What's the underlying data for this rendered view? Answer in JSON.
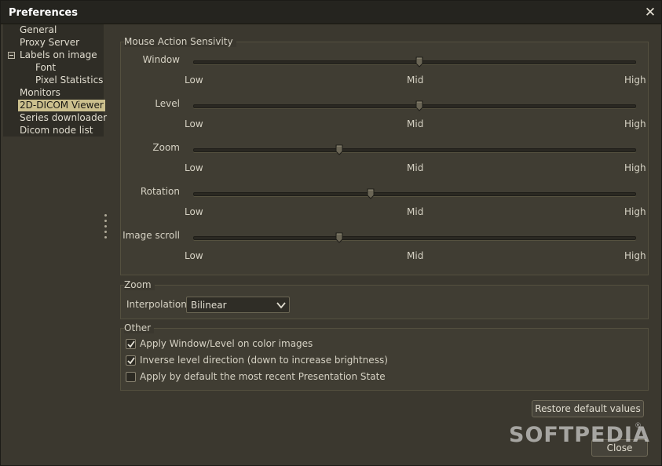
{
  "window": {
    "title": "Preferences"
  },
  "tree": [
    {
      "label": "General",
      "level": 1,
      "selected": false
    },
    {
      "label": "Proxy Server",
      "level": 1,
      "selected": false
    },
    {
      "label": "Labels on image",
      "level": 1,
      "selected": false,
      "expanded": true
    },
    {
      "label": "Font",
      "level": 2,
      "selected": false
    },
    {
      "label": "Pixel Statistics",
      "level": 2,
      "selected": false
    },
    {
      "label": "Monitors",
      "level": 1,
      "selected": false
    },
    {
      "label": "2D-DICOM Viewer",
      "level": 1,
      "selected": true
    },
    {
      "label": "Series downloader",
      "level": 1,
      "selected": false
    },
    {
      "label": "Dicom node list",
      "level": 1,
      "selected": false
    }
  ],
  "mouse": {
    "title": "Mouse Action Sensivity",
    "low": "Low",
    "mid": "Mid",
    "high": "High",
    "sliders": [
      {
        "label": "Window",
        "value": 0.51
      },
      {
        "label": "Level",
        "value": 0.51
      },
      {
        "label": "Zoom",
        "value": 0.33
      },
      {
        "label": "Rotation",
        "value": 0.4
      },
      {
        "label": "Image scroll",
        "value": 0.33
      }
    ]
  },
  "zoom": {
    "title": "Zoom",
    "interpolation_label": "Interpolation:",
    "interpolation_value": "Bilinear"
  },
  "other": {
    "title": "Other",
    "options": [
      {
        "label": "Apply Window/Level on color images",
        "checked": true
      },
      {
        "label": "Inverse level direction (down to increase brightness)",
        "checked": true
      },
      {
        "label": "Apply by default the most recent Presentation State",
        "checked": false
      }
    ]
  },
  "buttons": {
    "restore": "Restore default values",
    "close": "Close"
  },
  "watermark": "SOFTPEDIA",
  "watermark_mark": "®",
  "colors": {
    "selected_bg": "#cbbf8d",
    "panel_bg": "#3b382f",
    "titlebar_bg": "#25241f"
  }
}
